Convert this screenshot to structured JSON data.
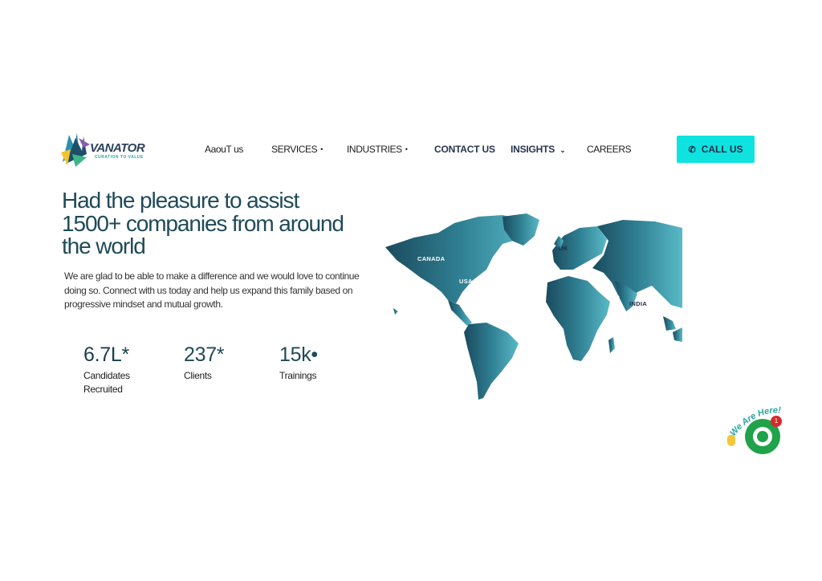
{
  "brand": {
    "name": "VANATOR",
    "tagline": "CURATION TO VALUE"
  },
  "nav": {
    "items": [
      {
        "label": "AaouT us"
      },
      {
        "label": "SERVICES",
        "marker": "•"
      },
      {
        "label": "INDUSTRIES",
        "marker": "•"
      },
      {
        "label": "CONTACT US"
      },
      {
        "label": "INSIGHTS",
        "marker": "⌄"
      },
      {
        "label": "CAREERS"
      }
    ],
    "call_button": {
      "label": "CALL US",
      "icon": "phone-icon"
    }
  },
  "hero": {
    "headline_line1": "Had the pleasure to assist",
    "headline_line2": "1500+ companies from around",
    "headline_line3": "the world",
    "lead": "We are glad to be able to make a difference and we would love to continue doing so. Connect with us today and help us expand this family based on progressive mindset and mutual growth."
  },
  "stats": [
    {
      "value": "6.7L*",
      "label": "Candidates Recruited"
    },
    {
      "value": "237*",
      "label": "Clients"
    },
    {
      "value": "15k•",
      "label": "Trainings"
    }
  ],
  "map": {
    "labels": [
      "CANADA",
      "USA",
      "UK",
      "INDIA"
    ],
    "colors": {
      "dark": "#1b4a5e",
      "light": "#4fb3c4"
    }
  },
  "widget": {
    "text": "We Are Here!",
    "badge_count": "1",
    "icon": "chat-bubble-icon"
  },
  "colors": {
    "accent": "#0ee3e0",
    "heading": "#1f4a58",
    "nav_bold": "#28344f",
    "chat_green": "#1fa24a"
  }
}
